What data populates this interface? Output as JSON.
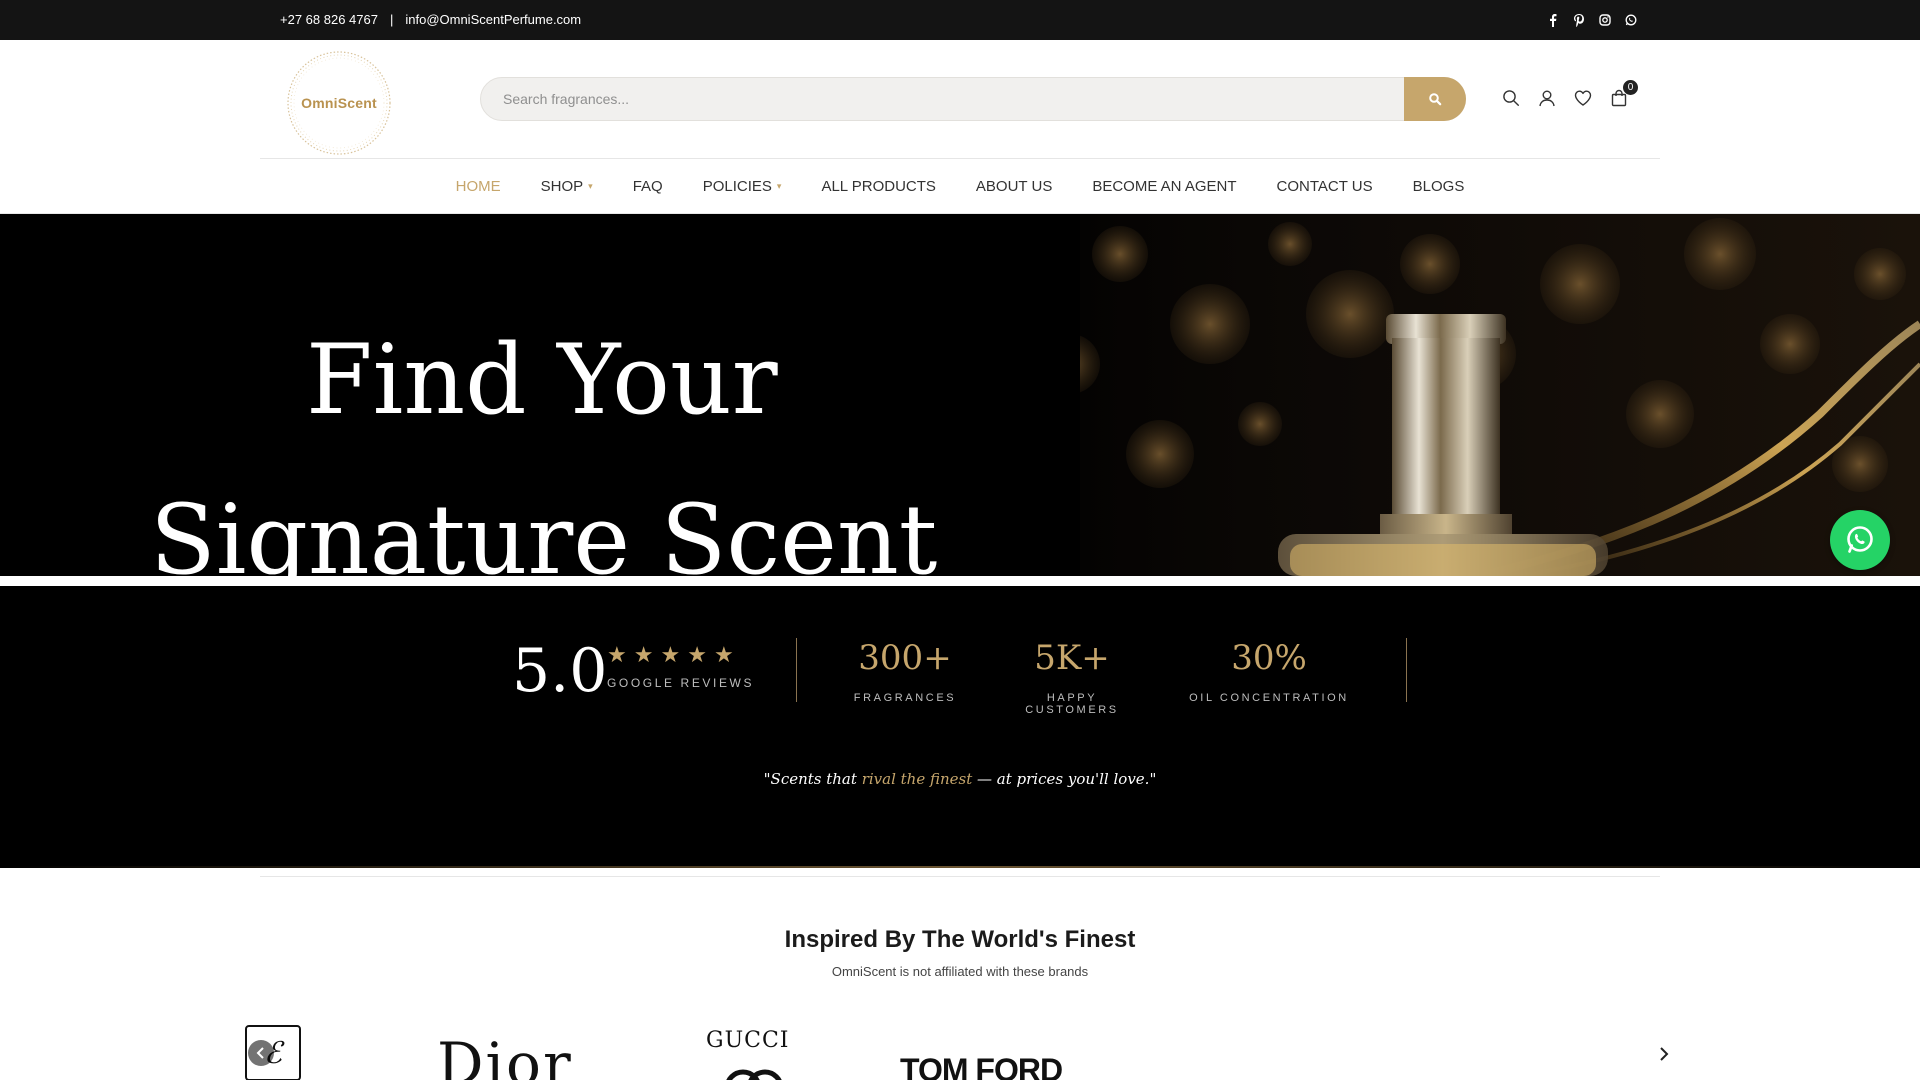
{
  "topbar": {
    "phone": "+27 68 826 4767",
    "separator": "|",
    "email": "info@OmniScentPerfume.com",
    "social_icons": [
      "facebook-icon",
      "pinterest-icon",
      "instagram-icon",
      "whatsapp-icon"
    ]
  },
  "header": {
    "logo_text": "OmniScent",
    "search_placeholder": "Search fragrances...",
    "icons": [
      "search-icon",
      "user-icon",
      "heart-icon",
      "bag-icon"
    ],
    "cart_count": "0"
  },
  "nav": {
    "items": [
      {
        "label": "HOME",
        "active": true,
        "dropdown": false
      },
      {
        "label": "SHOP",
        "active": false,
        "dropdown": true
      },
      {
        "label": "FAQ",
        "active": false,
        "dropdown": false
      },
      {
        "label": "POLICIES",
        "active": false,
        "dropdown": true
      },
      {
        "label": "ALL PRODUCTS",
        "active": false,
        "dropdown": false
      },
      {
        "label": "ABOUT US",
        "active": false,
        "dropdown": false
      },
      {
        "label": "BECOME AN AGENT",
        "active": false,
        "dropdown": false
      },
      {
        "label": "CONTACT US",
        "active": false,
        "dropdown": false
      },
      {
        "label": "BLOGS",
        "active": false,
        "dropdown": false
      }
    ],
    "caret": "▾"
  },
  "hero": {
    "line1": "Find Your",
    "line2": "Signature Scent"
  },
  "stats": {
    "rating": "5.0",
    "stars": 5,
    "rating_label": "GOOGLE REVIEWS",
    "items": [
      {
        "value": "300+",
        "label": "FRAGRANCES"
      },
      {
        "value": "5K+",
        "label": "HAPPY CUSTOMERS"
      },
      {
        "value": "30%",
        "label": "OIL CONCENTRATION"
      }
    ],
    "quote_start": "\"Scents that ",
    "quote_highlight": "rival the finest",
    "quote_end": " — at prices you'll love.\""
  },
  "brands": {
    "title": "Inspired By The World's Finest",
    "subtitle": "OmniScent is not affiliated with these brands",
    "logos": {
      "estee": "ℰ",
      "dior": "Dior",
      "gucci": "GUCCI",
      "tomford": "TOM FORD"
    }
  },
  "colors": {
    "accent_gold": "#c6a66c",
    "topbar_bg": "#141414",
    "whatsapp_green": "#25d366"
  }
}
